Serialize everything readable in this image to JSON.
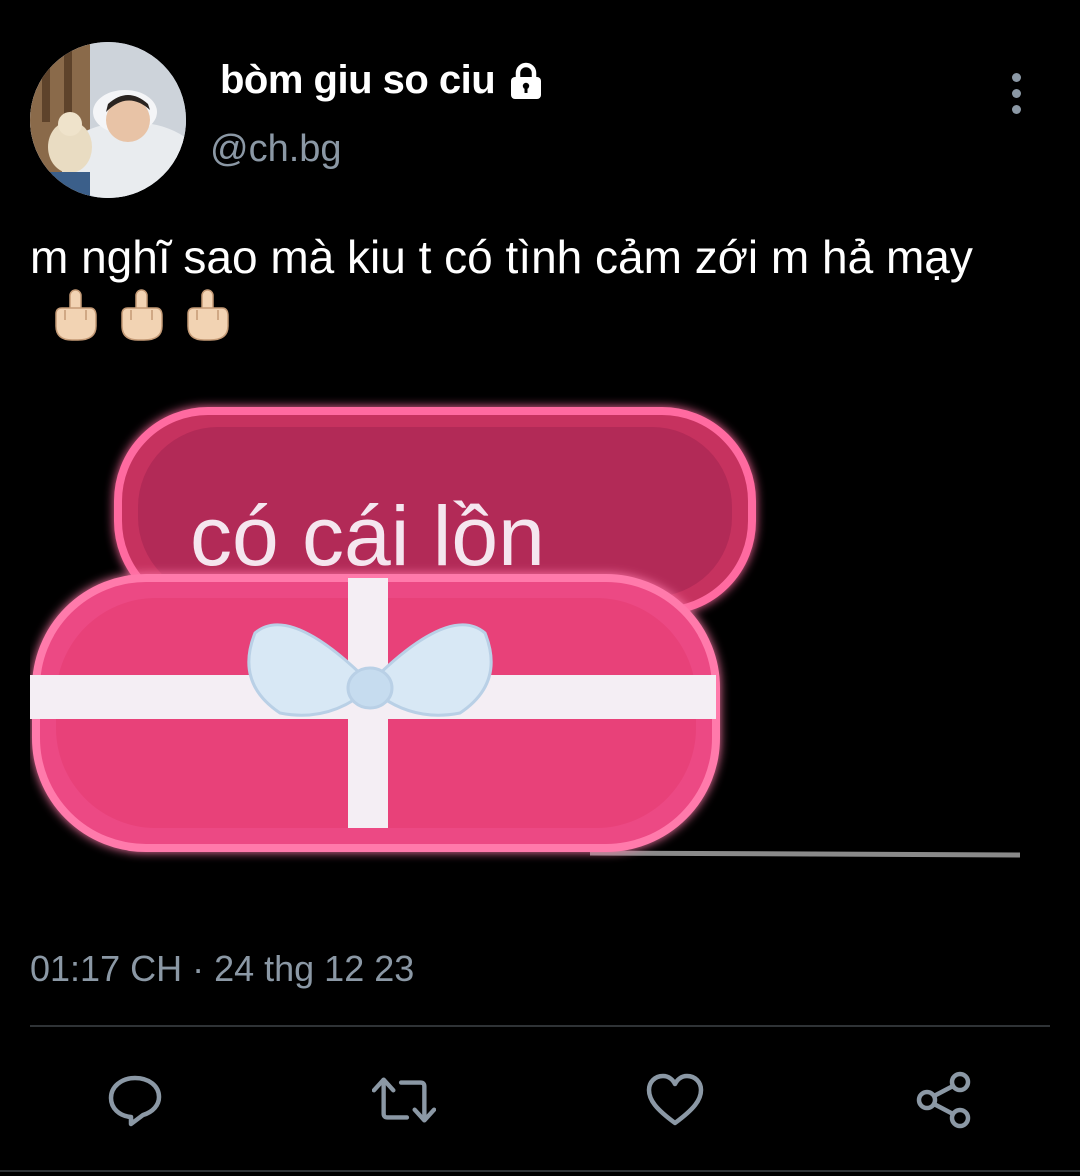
{
  "author": {
    "display_name": "bòm giu so ciu",
    "handle": "@ch.bg",
    "protected_icon": "lock-icon",
    "avatar": "avatar-sleeping-baby"
  },
  "tweet": {
    "text": "m nghĩ sao mà kiu t có tình cảm zới m hả mạy",
    "emoji": [
      "🖕🏻",
      "🖕🏻",
      "🖕🏻"
    ],
    "media": {
      "caption_text": "có cái lồn",
      "accent_color": "#e8407f"
    },
    "timestamp": "01:17 CH · 24 thg 12 23"
  },
  "actions": [
    {
      "name": "reply",
      "icon": "reply-icon"
    },
    {
      "name": "retweet",
      "icon": "retweet-icon"
    },
    {
      "name": "like",
      "icon": "heart-icon"
    },
    {
      "name": "share",
      "icon": "share-icon"
    }
  ],
  "colors": {
    "background": "#000000",
    "secondary_text": "#8b98a5",
    "divider": "#2f3336"
  }
}
